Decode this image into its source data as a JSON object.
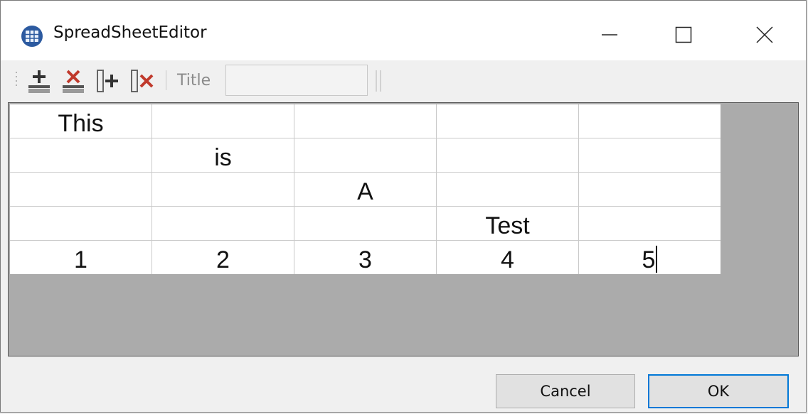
{
  "window": {
    "title": "SpreadSheetEditor"
  },
  "toolbar": {
    "buttons": [
      {
        "icon": "add-row-icon"
      },
      {
        "icon": "delete-row-icon"
      },
      {
        "icon": "add-column-icon"
      },
      {
        "icon": "delete-column-icon"
      }
    ],
    "title_label": "Title",
    "title_value": ""
  },
  "grid": {
    "rows": [
      [
        "This",
        "",
        "",
        "",
        ""
      ],
      [
        "",
        "is",
        "",
        "",
        ""
      ],
      [
        "",
        "",
        "A",
        "",
        ""
      ],
      [
        "",
        "",
        "",
        "Test",
        ""
      ],
      [
        "1",
        "2",
        "3",
        "4",
        "5"
      ]
    ]
  },
  "buttons": {
    "cancel": "Cancel",
    "ok": "OK"
  },
  "colors": {
    "accent": "#0078d7",
    "grid_bg": "#ababab",
    "delete_red": "#c0392b"
  }
}
